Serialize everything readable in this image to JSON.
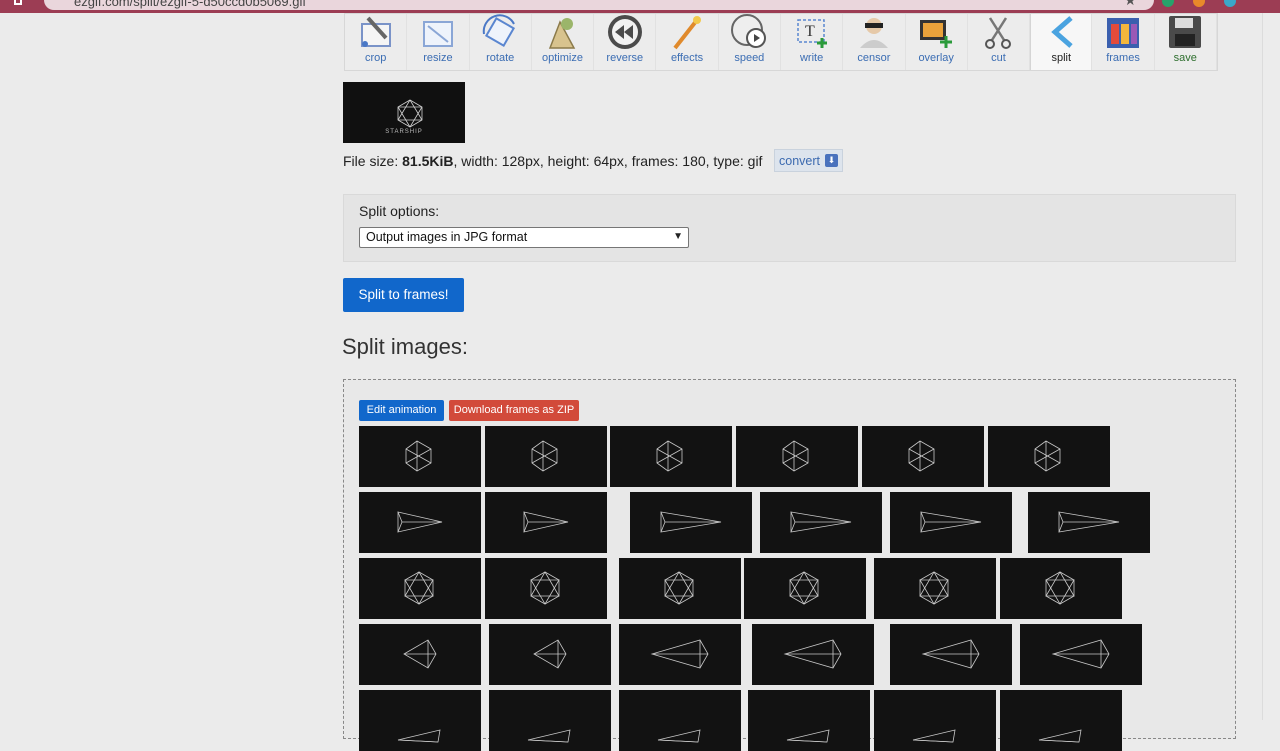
{
  "browser": {
    "url": "ezgif.com/split/ezgif-5-d50ccd0b5069.gif"
  },
  "toolbar": {
    "items": [
      {
        "label": "crop",
        "icon": "crop-icon"
      },
      {
        "label": "resize",
        "icon": "resize-icon"
      },
      {
        "label": "rotate",
        "icon": "rotate-icon"
      },
      {
        "label": "optimize",
        "icon": "optimize-icon"
      },
      {
        "label": "reverse",
        "icon": "reverse-icon"
      },
      {
        "label": "effects",
        "icon": "effects-icon"
      },
      {
        "label": "speed",
        "icon": "speed-icon"
      },
      {
        "label": "write",
        "icon": "write-icon"
      },
      {
        "label": "censor",
        "icon": "censor-icon"
      },
      {
        "label": "overlay",
        "icon": "overlay-icon"
      },
      {
        "label": "cut",
        "icon": "cut-icon"
      },
      {
        "label": "split",
        "icon": "split-icon"
      },
      {
        "label": "frames",
        "icon": "frames-icon"
      },
      {
        "label": "save",
        "icon": "save-icon"
      }
    ]
  },
  "preview": {
    "logo_text": "STARSHIP"
  },
  "fileinfo": {
    "size_label": "File size: ",
    "size_value": "81.5KiB",
    "rest": ", width: 128px, height: 64px, frames: 180, type: gif",
    "convert_label": "convert"
  },
  "options": {
    "title": "Split options:",
    "selected": "Output images in JPG format"
  },
  "split_button": "Split to frames!",
  "heading": "Split images:",
  "edit_button": "Edit animation",
  "zip_button": "Download frames as ZIP",
  "colors": {
    "primary": "#1167cb",
    "danger": "#d24a3a",
    "chrome": "#9c3d54"
  }
}
